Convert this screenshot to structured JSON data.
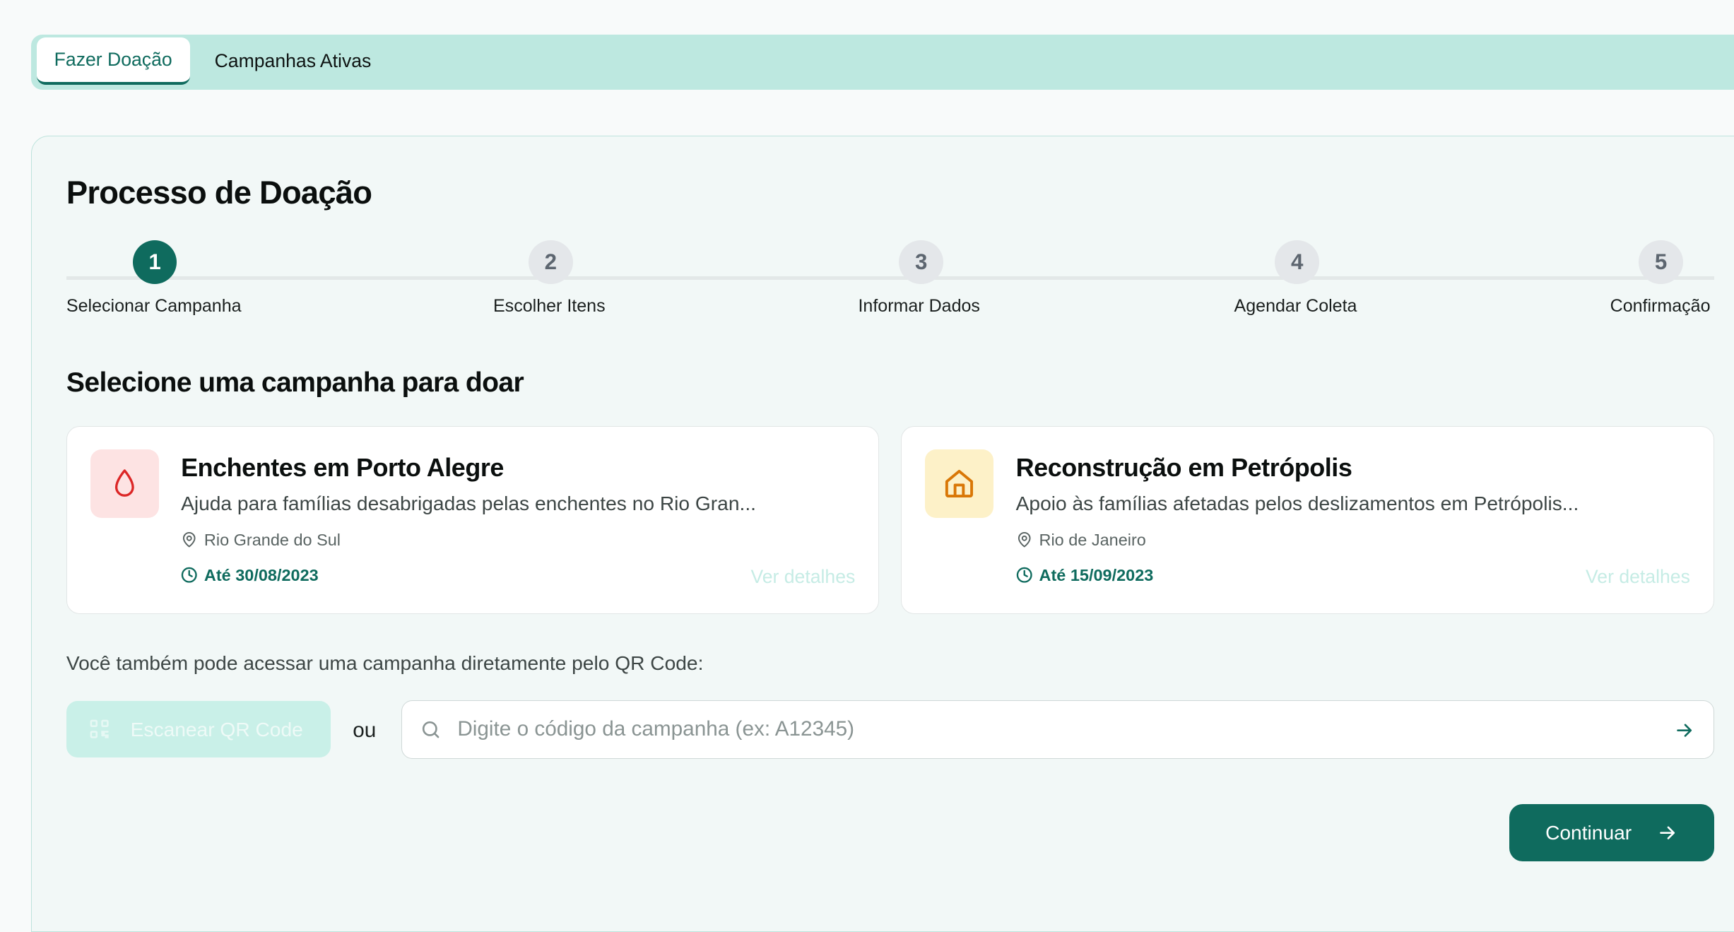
{
  "tabs": [
    {
      "label": "Fazer Doação",
      "active": true
    },
    {
      "label": "Campanhas Ativas",
      "active": false
    }
  ],
  "page_title": "Processo de Doação",
  "stepper": {
    "current": 1,
    "steps": [
      {
        "number": "1",
        "label": "Selecionar Campanha"
      },
      {
        "number": "2",
        "label": "Escolher Itens"
      },
      {
        "number": "3",
        "label": "Informar Dados"
      },
      {
        "number": "4",
        "label": "Agendar Coleta"
      },
      {
        "number": "5",
        "label": "Confirmação"
      }
    ]
  },
  "section_title": "Selecione uma campanha para doar",
  "campaigns": [
    {
      "icon": "droplet-icon",
      "icon_bg": "#fde3e3",
      "icon_color": "#dc2626",
      "title": "Enchentes em Porto Alegre",
      "description": "Ajuda para famílias desabrigadas pelas enchentes no Rio Gran...",
      "location": "Rio Grande do Sul",
      "deadline": "Até 30/08/2023",
      "details_link": "Ver detalhes"
    },
    {
      "icon": "home-icon",
      "icon_bg": "#fdf1c8",
      "icon_color": "#d97706",
      "title": "Reconstrução em Petrópolis",
      "description": "Apoio às famílias afetadas pelos deslizamentos em Petrópolis...",
      "location": "Rio de Janeiro",
      "deadline": "Até 15/09/2023",
      "details_link": "Ver detalhes"
    }
  ],
  "qr": {
    "hint": "Você também pode acessar uma campanha diretamente pelo QR Code:",
    "scan_button": "Escanear QR Code",
    "or_label": "ou",
    "code_placeholder": "Digite o código da campanha (ex: A12345)",
    "code_value": ""
  },
  "continue_button": "Continuar",
  "colors": {
    "primary": "#0f6b5e",
    "tab_bar": "#bde8e0",
    "panel_bg": "#f2f8f7"
  }
}
